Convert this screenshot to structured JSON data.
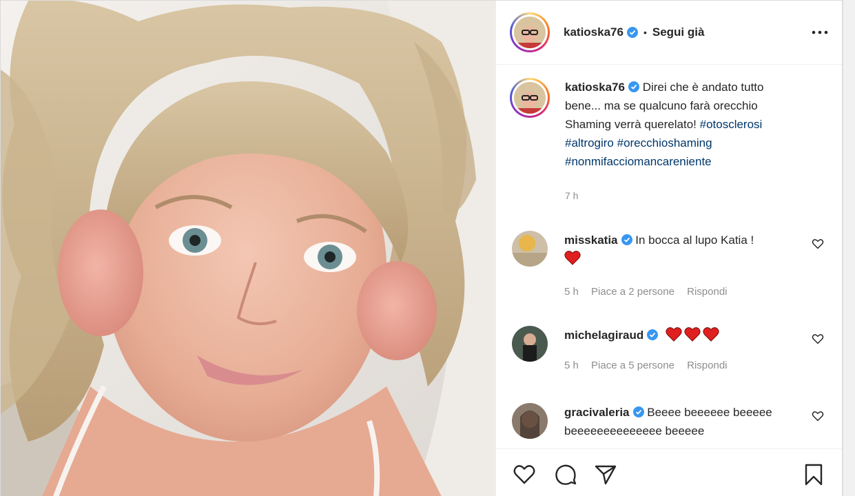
{
  "post": {
    "username": "katioska76",
    "follow_status": "Segui già",
    "separator": "•"
  },
  "caption": {
    "username": "katioska76",
    "text": "Direi che è andato tutto bene... ma se qualcuno farà orecchio Shaming verrà querelato! ",
    "hashtags": [
      "#otosclerosi",
      "#altrogiro",
      "#orecchioshaming",
      "#nonmifacciomancareniente"
    ],
    "time": "7 h"
  },
  "comments": [
    {
      "username": "misskatia",
      "text": "In bocca al lupo Katia !",
      "hearts": 1,
      "time": "5 h",
      "likes": "Piace a 2 persone",
      "reply": "Rispondi"
    },
    {
      "username": "michelagiraud",
      "text": "",
      "hearts": 3,
      "time": "5 h",
      "likes": "Piace a 5 persone",
      "reply": "Rispondi"
    },
    {
      "username": "gracivaleria",
      "text": "Beeee beeeeee beeeee beeeeeeeeeeeeee beeeee"
    }
  ],
  "colors": {
    "hashtag": "#00376b",
    "verified": "#3897f0",
    "heart": "#ed4956",
    "muted": "#8e8e8e"
  },
  "icons": [
    "verified-badge-icon",
    "more-options-icon",
    "like-icon",
    "comment-icon",
    "share-icon",
    "save-icon",
    "comment-like-icon",
    "red-heart-emoji"
  ]
}
